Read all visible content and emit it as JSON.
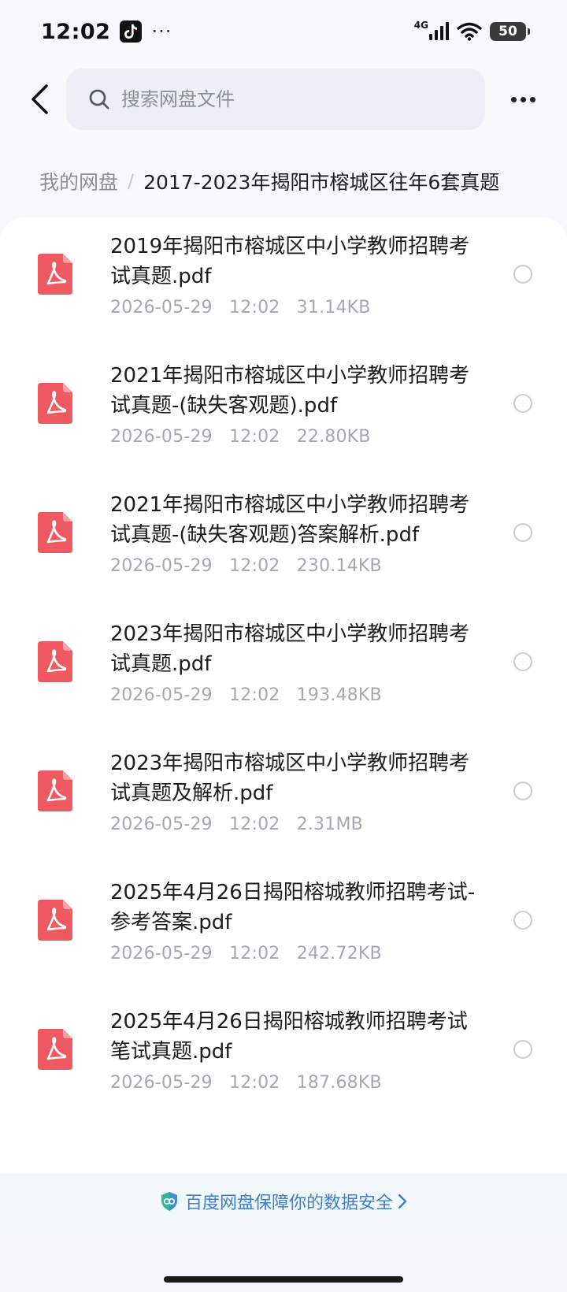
{
  "status_bar": {
    "time": "12:02",
    "dots": "···",
    "network": "4G",
    "battery": "50",
    "icons": [
      "tiktok-icon",
      "signal-icon",
      "wifi-icon",
      "battery-icon"
    ]
  },
  "header": {
    "search_placeholder": "搜索网盘文件",
    "icons": [
      "back-arrow-icon",
      "search-icon",
      "more-dots-icon"
    ]
  },
  "breadcrumb": {
    "root": "我的网盘",
    "separator": "/",
    "current": "2017-2023年揭阳市榕城区往年6套真题"
  },
  "files": [
    {
      "name": "2019年揭阳市榕城区中小学教师招聘考试真题.pdf",
      "date": "2026-05-29",
      "time": "12:02",
      "size": "31.14KB"
    },
    {
      "name": "2021年揭阳市榕城区中小学教师招聘考试真题-(缺失客观题).pdf",
      "date": "2026-05-29",
      "time": "12:02",
      "size": "22.80KB"
    },
    {
      "name": "2021年揭阳市榕城区中小学教师招聘考试真题-(缺失客观题)答案解析.pdf",
      "date": "2026-05-29",
      "time": "12:02",
      "size": "230.14KB"
    },
    {
      "name": "2023年揭阳市榕城区中小学教师招聘考试真题.pdf",
      "date": "2026-05-29",
      "time": "12:02",
      "size": "193.48KB"
    },
    {
      "name": "2023年揭阳市榕城区中小学教师招聘考试真题及解析.pdf",
      "date": "2026-05-29",
      "time": "12:02",
      "size": "2.31MB"
    },
    {
      "name": "2025年4月26日揭阳榕城教师招聘考试-参考答案.pdf",
      "date": "2026-05-29",
      "time": "12:02",
      "size": "242.72KB"
    },
    {
      "name": "2025年4月26日揭阳榕城教师招聘考试笔试真题.pdf",
      "date": "2026-05-29",
      "time": "12:02",
      "size": "187.68KB"
    }
  ],
  "footer": {
    "text": "百度网盘保障你的数据安全"
  },
  "colors": {
    "pdf_icon": "#ef5a62",
    "footer_link": "#3e7fc7",
    "meta_text": "#a4a8b0"
  }
}
